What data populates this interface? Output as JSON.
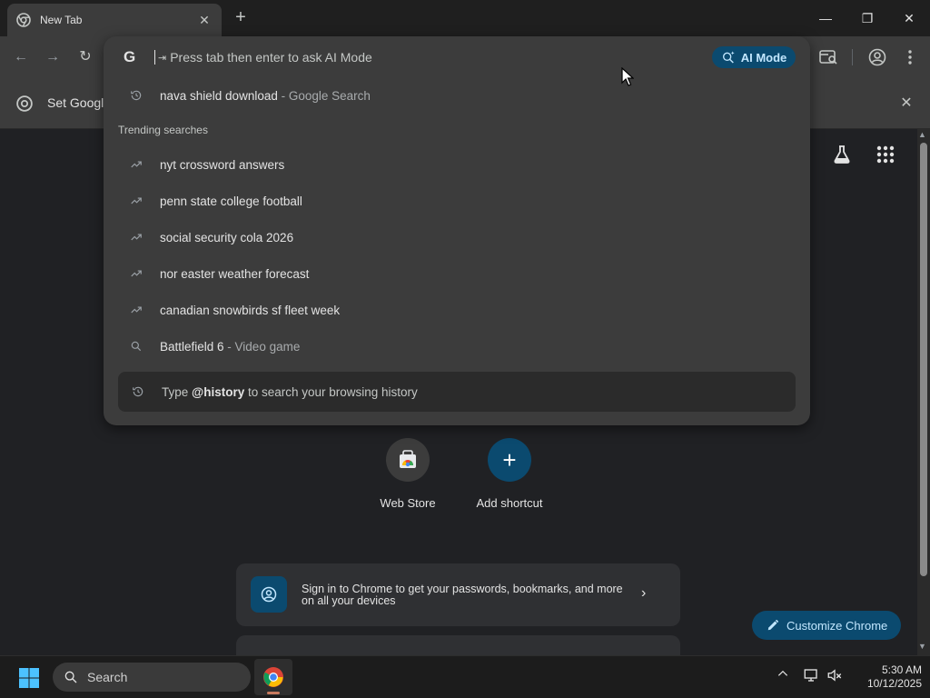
{
  "browser": {
    "tab_title": "New Tab",
    "new_tab_symbol": "+",
    "window_controls": {
      "minimize": "—",
      "restore": "❐",
      "close": "✕"
    }
  },
  "infobar": {
    "text": "Set Google"
  },
  "omnibox": {
    "placeholder": "Press tab then enter to ask AI Mode",
    "ai_mode_label": "AI Mode",
    "recent": {
      "query": "nava shield download",
      "suffix": " - Google Search"
    },
    "trending_header": "Trending searches",
    "trending": [
      "nyt crossword answers",
      "penn state college football",
      "social security cola 2026",
      "nor easter weather forecast",
      "canadian snowbirds sf fleet week"
    ],
    "entity": {
      "query": "Battlefield 6",
      "suffix": " - Video game"
    },
    "history_hint": {
      "prefix": "Type ",
      "keyword": "@history",
      "suffix": " to search your browsing history"
    }
  },
  "ntp": {
    "shortcuts": [
      {
        "label": "Web Store"
      },
      {
        "label": "Add shortcut"
      }
    ],
    "signin_card": {
      "text": "Sign in to Chrome to get your passwords, bookmarks, and more on all your devices"
    },
    "customize_label": "Customize Chrome"
  },
  "taskbar": {
    "search_label": "Search",
    "time": "5:30 AM",
    "date": "10/12/2025"
  },
  "colors": {
    "accent_pill": "#0b4a6f",
    "accent_text": "#c2e7ff",
    "omnibox_bg": "#3c3c3c",
    "page_bg": "#202124"
  }
}
